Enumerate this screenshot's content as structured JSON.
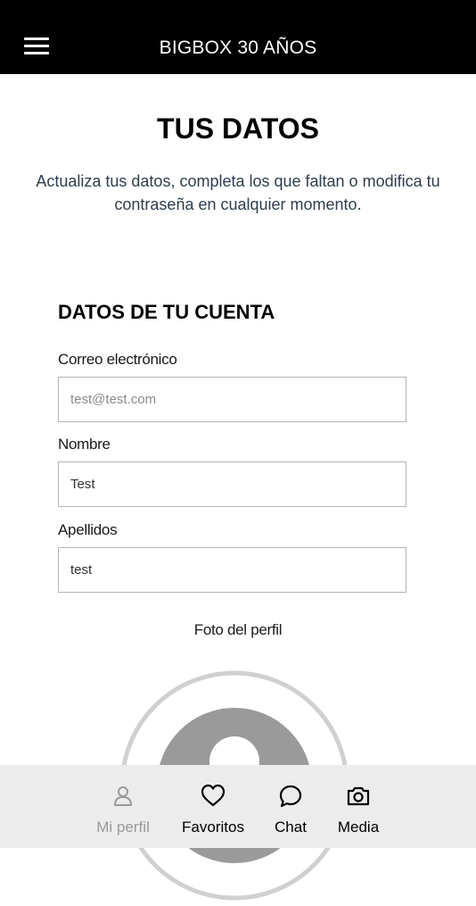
{
  "header": {
    "menu_icon": "hamburger-menu-icon",
    "title": "BIGBOX 30 AÑOS"
  },
  "page": {
    "title": "TUS DATOS",
    "intro": "Actualiza tus datos, completa los que faltan o modifica tu contraseña en cualquier momento."
  },
  "account": {
    "section_title": "DATOS DE TU CUENTA",
    "email": {
      "label": "Correo electrónico",
      "value": "",
      "placeholder": "test@test.com"
    },
    "first_name": {
      "label": "Nombre",
      "value": "Test"
    },
    "last_name": {
      "label": "Apellidos",
      "value": "test"
    },
    "photo_label": "Foto del perfil"
  },
  "tabbar": {
    "tabs": [
      {
        "label": "Mi perfil",
        "icon": "person-icon",
        "active": false
      },
      {
        "label": "Favoritos",
        "icon": "heart-icon",
        "active": true
      },
      {
        "label": "Chat",
        "icon": "chat-bubble-icon",
        "active": true
      },
      {
        "label": "Media",
        "icon": "camera-icon",
        "active": true
      }
    ]
  },
  "colors": {
    "header_bg": "#000000",
    "tabbar_bg": "#ececec",
    "inactive_tab": "#9a9a9a",
    "avatar_gray": "#9a9a9a"
  }
}
